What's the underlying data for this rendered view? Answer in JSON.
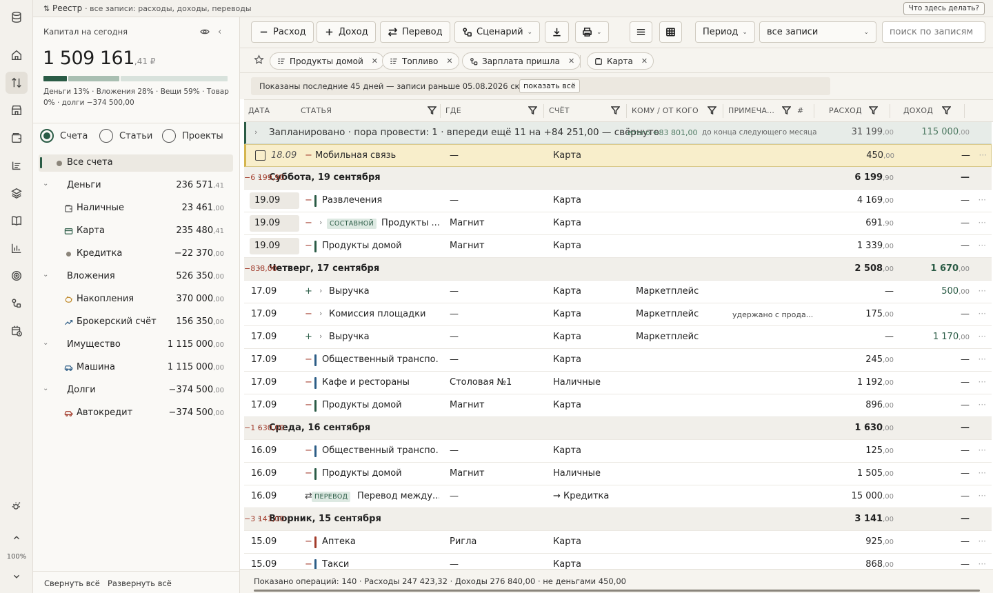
{
  "topbar": {
    "icon": "sort-arrows-icon",
    "title": "Реестр",
    "subtitle": "· все записи: расходы, доходы, переводы",
    "help": "Что здесь делать?"
  },
  "rail": {
    "zoom": "100%"
  },
  "sidebar": {
    "capital_title": "Капитал на сегодня",
    "capital_main": "1 509 161",
    "capital_kop": ",41 ₽",
    "structure_fractions": [
      0.13,
      0.28,
      0.59
    ],
    "structure_colors": [
      "#2a5b45",
      "#a9bfb2",
      "#d8e2dc"
    ],
    "legend": "Деньги 13% · Вложения 28% · Вещи 59% · Товар 0% · долги −374 500,00",
    "radios": {
      "accounts": "Счета",
      "articles": "Статьи",
      "projects": "Проекты"
    },
    "all_accounts": "Все счета",
    "accounts": [
      {
        "name": "Деньги",
        "main": "236 571",
        "kop": ",41",
        "level": 0,
        "icon": "chevron-down-icon"
      },
      {
        "name": "Наличные",
        "main": "23 461",
        "kop": ",00",
        "level": 1,
        "icon": "wallet-icon"
      },
      {
        "name": "Карта",
        "main": "235 480",
        "kop": ",41",
        "level": 1,
        "icon": "card-icon"
      },
      {
        "name": "Кредитка",
        "main": "−22 370",
        "kop": ",00",
        "level": 1,
        "icon": "dot-icon"
      },
      {
        "name": "Вложения",
        "main": "526 350",
        "kop": ",00",
        "level": 0,
        "icon": "chevron-down-icon"
      },
      {
        "name": "Накопления",
        "main": "370 000",
        "kop": ",00",
        "level": 1,
        "icon": "piggy-icon"
      },
      {
        "name": "Брокерский счёт",
        "main": "156 350",
        "kop": ",00",
        "level": 1,
        "icon": "trend-icon"
      },
      {
        "name": "Имущество",
        "main": "1 115 000",
        "kop": ",00",
        "level": 0,
        "icon": "chevron-down-icon"
      },
      {
        "name": "Машина",
        "main": "1 115 000",
        "kop": ",00",
        "level": 1,
        "icon": "car-icon"
      },
      {
        "name": "Долги",
        "main": "−374 500",
        "kop": ",00",
        "level": 0,
        "icon": "chevron-down-icon"
      },
      {
        "name": "Автокредит",
        "main": "−374 500",
        "kop": ",00",
        "level": 1,
        "icon": "car-red-icon"
      }
    ],
    "collapse_all": "Свернуть всё",
    "expand_all": "Развернуть всё"
  },
  "toolbar": {
    "expense": "Расход",
    "income": "Доход",
    "transfer": "Перевод",
    "scenario": "Сценарий",
    "period": "Период",
    "filter_value": "все записи",
    "search_placeholder": "поиск по записям"
  },
  "chips": [
    "Продукты домой",
    "Топливо",
    "Зарплата пришла",
    "Карта"
  ],
  "notice": {
    "text": "Показаны последние 45 дней — записи раньше 05.08.2026 скрыты",
    "button": "показать всё"
  },
  "columns": {
    "date": "ДАТА",
    "category": "СТАТЬЯ",
    "where": "ГДЕ",
    "account": "СЧЁТ",
    "who": "КОМУ / ОТ КОГО",
    "note": "ПРИМЕЧА...",
    "hash": "#",
    "expense": "РАСХОД",
    "income": "ДОХОД"
  },
  "planned": {
    "text": "Запланировано · пора провести: 1 · впереди ещё 11 на +84 251,00 — свёрнуто",
    "total": "итого +83 801,00",
    "until": "до конца следующего месяца ч",
    "expense_main": "31 199",
    "expense_kop": ",00",
    "income_main": "115 000",
    "income_kop": ",00"
  },
  "pending": {
    "date": "18.09",
    "sign": "−",
    "category": "Мобильная связь",
    "where": "—",
    "account": "Карта",
    "expense_main": "450",
    "expense_kop": ",00",
    "income": "—",
    "more": "···"
  },
  "rows": [
    {
      "type": "group",
      "title": "Суббота, 19 сентября",
      "delta": "−6 199,90",
      "expense_main": "6 199",
      "expense_kop": ",90",
      "income_main": "—",
      "income_kop": ""
    },
    {
      "type": "row",
      "date": "19.09",
      "dateBox": true,
      "sign": "−",
      "bar": "#2a5b45",
      "category": "Развлечения",
      "where": "—",
      "account": "Карта",
      "who": "",
      "note": "",
      "expense_main": "4 169",
      "expense_kop": ",00",
      "income_main": "—",
      "income_kop": ""
    },
    {
      "type": "row",
      "date": "19.09",
      "dateBox": true,
      "sign": "−",
      "expand": "›",
      "badge": "СОСТАВНОЙ",
      "category": "Продукты ...",
      "where": "Магнит",
      "account": "Карта",
      "who": "",
      "note": "",
      "expense_main": "691",
      "expense_kop": ",90",
      "income_main": "—",
      "income_kop": ""
    },
    {
      "type": "row",
      "date": "19.09",
      "dateBox": true,
      "sign": "−",
      "bar": "#2a5b45",
      "category": "Продукты домой",
      "where": "Магнит",
      "account": "Карта",
      "who": "",
      "note": "",
      "expense_main": "1 339",
      "expense_kop": ",00",
      "income_main": "—",
      "income_kop": ""
    },
    {
      "type": "group",
      "title": "Четверг, 17 сентября",
      "delta": "−838,00",
      "expense_main": "2 508",
      "expense_kop": ",00",
      "income_main": "1 670",
      "income_kop": ",00"
    },
    {
      "type": "row",
      "date": "17.09",
      "sign": "+",
      "expand": "›",
      "category": "Выручка",
      "where": "—",
      "account": "Карта",
      "who": "Маркетплейс",
      "note": "",
      "expense_main": "—",
      "expense_kop": "",
      "income_main": "500",
      "income_kop": ",00"
    },
    {
      "type": "row",
      "date": "17.09",
      "sign": "−",
      "expand": "›",
      "category": "Комиссия площадки",
      "where": "—",
      "account": "Карта",
      "who": "Маркетплейс",
      "note": "удержано с прода...",
      "expense_main": "175",
      "expense_kop": ",00",
      "income_main": "—",
      "income_kop": ""
    },
    {
      "type": "row",
      "date": "17.09",
      "sign": "+",
      "expand": "›",
      "category": "Выручка",
      "where": "—",
      "account": "Карта",
      "who": "Маркетплейс",
      "note": "",
      "expense_main": "—",
      "expense_kop": "",
      "income_main": "1 170",
      "income_kop": ",00"
    },
    {
      "type": "row",
      "date": "17.09",
      "sign": "−",
      "bar": "#2c5d86",
      "category": "Общественный транспо...",
      "where": "—",
      "account": "Карта",
      "who": "",
      "note": "",
      "expense_main": "245",
      "expense_kop": ",00",
      "income_main": "—",
      "income_kop": ""
    },
    {
      "type": "row",
      "date": "17.09",
      "sign": "−",
      "bar": "#2c5d86",
      "category": "Кафе и рестораны",
      "where": "Столовая №1",
      "account": "Наличные",
      "who": "",
      "note": "",
      "expense_main": "1 192",
      "expense_kop": ",00",
      "income_main": "—",
      "income_kop": ""
    },
    {
      "type": "row",
      "date": "17.09",
      "sign": "−",
      "bar": "#2a5b45",
      "category": "Продукты домой",
      "where": "Магнит",
      "account": "Карта",
      "who": "",
      "note": "",
      "expense_main": "896",
      "expense_kop": ",00",
      "income_main": "—",
      "income_kop": ""
    },
    {
      "type": "group",
      "title": "Среда, 16 сентября",
      "delta": "−1 630,00",
      "expense_main": "1 630",
      "expense_kop": ",00",
      "income_main": "—",
      "income_kop": ""
    },
    {
      "type": "row",
      "date": "16.09",
      "sign": "−",
      "bar": "#2c5d86",
      "category": "Общественный транспо...",
      "where": "—",
      "account": "Карта",
      "who": "",
      "note": "",
      "expense_main": "125",
      "expense_kop": ",00",
      "income_main": "—",
      "income_kop": ""
    },
    {
      "type": "row",
      "date": "16.09",
      "sign": "−",
      "bar": "#2a5b45",
      "category": "Продукты домой",
      "where": "Магнит",
      "account": "Наличные",
      "who": "",
      "note": "",
      "expense_main": "1 505",
      "expense_kop": ",00",
      "income_main": "—",
      "income_kop": ""
    },
    {
      "type": "row",
      "date": "16.09",
      "sign": "⇄",
      "badge": "ПЕРЕВОД",
      "category": "Перевод между...",
      "where": "—",
      "account": "→ Кредитка",
      "who": "",
      "note": "",
      "expense_main": "15 000",
      "expense_kop": ",00",
      "income_main": "—",
      "income_kop": ""
    },
    {
      "type": "group",
      "title": "Вторник, 15 сентября",
      "delta": "−3 141,00",
      "expense_main": "3 141",
      "expense_kop": ",00",
      "income_main": "—",
      "income_kop": ""
    },
    {
      "type": "row",
      "date": "15.09",
      "sign": "−",
      "bar": "#a23b2b",
      "category": "Аптека",
      "where": "Ригла",
      "account": "Карта",
      "who": "",
      "note": "",
      "expense_main": "925",
      "expense_kop": ",00",
      "income_main": "—",
      "income_kop": ""
    },
    {
      "type": "row",
      "date": "15.09",
      "sign": "−",
      "bar": "#2c5d86",
      "category": "Такси",
      "where": "—",
      "account": "Карта",
      "who": "",
      "note": "",
      "expense_main": "868",
      "expense_kop": ",00",
      "income_main": "—",
      "income_kop": ""
    }
  ],
  "status": {
    "text": "Показано операций: 140   ·   Расходы 247 423,32   ·   Доходы 276 840,00   ·   не деньгами 450,00"
  },
  "colors": {
    "accent": "#2a5b45",
    "negative": "#a23b2b",
    "planned_bg": "#e7ece8",
    "pending_bg": "#f8eecb"
  }
}
